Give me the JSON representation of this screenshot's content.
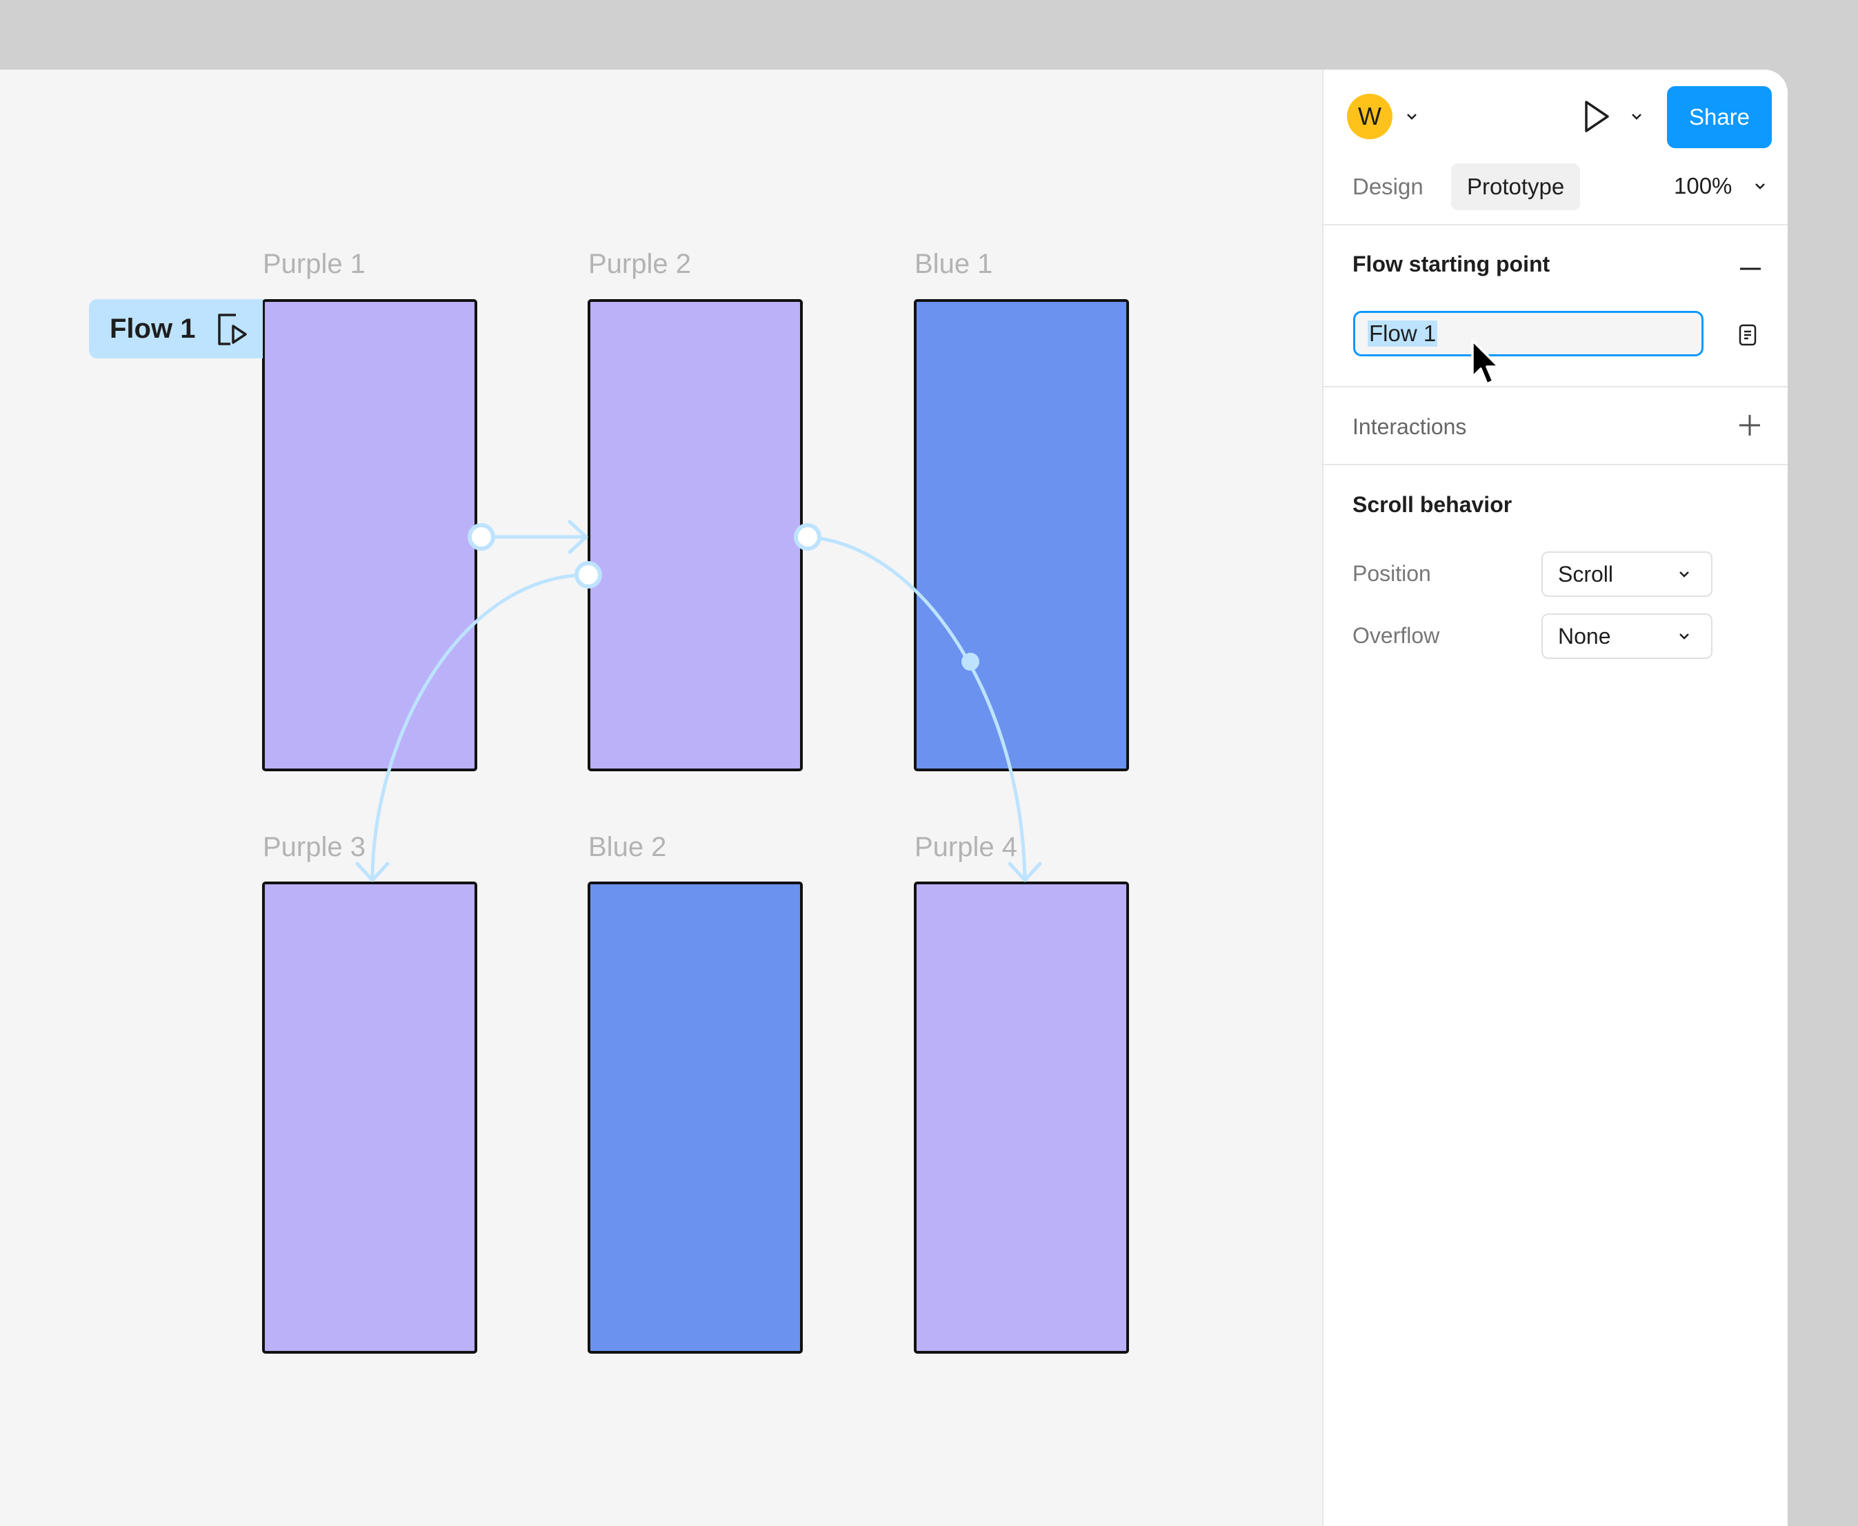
{
  "canvas": {
    "flow_badge": {
      "label": "Flow 1",
      "icon": "flow-play-icon"
    },
    "frames": [
      {
        "id": "purple-1",
        "label": "Purple 1",
        "color": "#bbb1f9"
      },
      {
        "id": "purple-2",
        "label": "Purple 2",
        "color": "#bbb1f9"
      },
      {
        "id": "blue-1",
        "label": "Blue 1",
        "color": "#6b92ee"
      },
      {
        "id": "purple-3",
        "label": "Purple 3",
        "color": "#bbb1f9"
      },
      {
        "id": "blue-2",
        "label": "Blue 2",
        "color": "#6b92ee"
      },
      {
        "id": "purple-4",
        "label": "Purple 4",
        "color": "#bbb1f9"
      }
    ],
    "connections": [
      {
        "from": "Purple 1",
        "to": "Purple 2"
      },
      {
        "from": "Purple 2",
        "to": "Purple 3"
      },
      {
        "from": "Purple 2",
        "to": "Purple 4"
      }
    ],
    "connector_color": "#bde3ff"
  },
  "toolbar": {
    "avatar_initial": "W",
    "avatar_color": "#ffc21a",
    "share_label": "Share",
    "share_color": "#0d99ff"
  },
  "tabs": {
    "design": "Design",
    "prototype": "Prototype",
    "active": "Prototype"
  },
  "zoom": "100%",
  "flow_section": {
    "title": "Flow starting point",
    "flow_name": "Flow 1",
    "collapse_icon": "minus-icon",
    "description_icon": "note-icon"
  },
  "interactions": {
    "title": "Interactions",
    "add_icon": "plus-icon"
  },
  "scroll_behavior": {
    "title": "Scroll behavior",
    "position_label": "Position",
    "position_value": "Scroll",
    "overflow_label": "Overflow",
    "overflow_value": "None"
  }
}
